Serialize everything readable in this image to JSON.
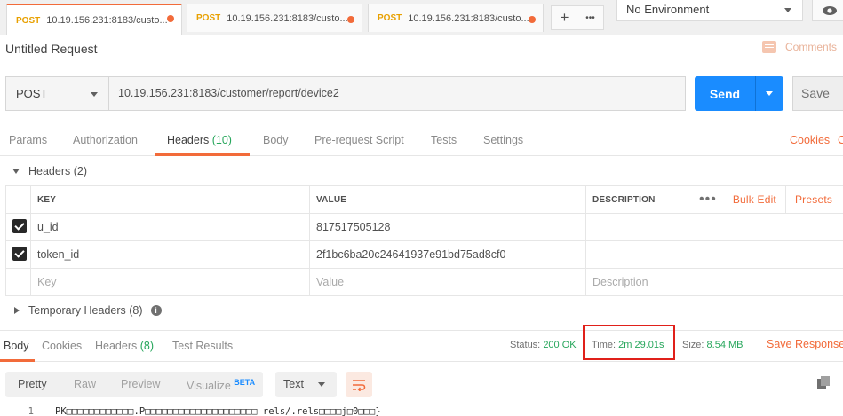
{
  "tabs": [
    {
      "method": "POST",
      "label": "10.19.156.231:8183/custo..."
    },
    {
      "method": "POST",
      "label": "10.19.156.231:8183/custo..."
    },
    {
      "method": "POST",
      "label": "10.19.156.231:8183/custo..."
    }
  ],
  "tab_controls": {
    "add": "+",
    "more": "•••"
  },
  "environment": {
    "selected": "No Environment"
  },
  "request": {
    "title": "Untitled Request",
    "comments_label": "Comments",
    "method": "POST",
    "url": "10.19.156.231:8183/customer/report/device2",
    "send_label": "Send",
    "save_label": "Save"
  },
  "request_tabs": {
    "params": "Params",
    "authorization": "Authorization",
    "headers": "Headers",
    "headers_count": "(10)",
    "body": "Body",
    "pre_request": "Pre-request Script",
    "tests": "Tests",
    "settings": "Settings",
    "cookies": "Cookies",
    "code": "C"
  },
  "headers_section": {
    "title": "Headers",
    "count": "(2)",
    "columns": {
      "key": "KEY",
      "value": "VALUE",
      "description": "DESCRIPTION"
    },
    "more": "•••",
    "bulk_edit": "Bulk Edit",
    "presets": "Presets",
    "rows": [
      {
        "key": "u_id",
        "value": "817517505128",
        "description": ""
      },
      {
        "key": "token_id",
        "value": "2f1bc6ba20c24641937e91bd75ad8cf0",
        "description": ""
      }
    ],
    "placeholder": {
      "key": "Key",
      "value": "Value",
      "description": "Description"
    },
    "temporary": {
      "title": "Temporary Headers",
      "count": "(8)"
    }
  },
  "response": {
    "tabs": {
      "body": "Body",
      "cookies": "Cookies",
      "headers": "Headers",
      "headers_count": "(8)",
      "test_results": "Test Results"
    },
    "status_label": "Status:",
    "status_value": "200 OK",
    "time_label": "Time:",
    "time_value": "2m 29.01s",
    "size_label": "Size:",
    "size_value": "8.54 MB",
    "save_label": "Save Response",
    "views": {
      "pretty": "Pretty",
      "raw": "Raw",
      "preview": "Preview",
      "visualize": "Visualize",
      "beta": "BETA"
    },
    "format": "Text",
    "line_number": "1",
    "line_text": "PK□□□□□□□□□□□□.P□□□□□□□□□□□□□□□□□□□□_rels/.rels□□□□j□0□□□}"
  },
  "colors": {
    "accent": "#f26b3a",
    "send": "#1a8cff",
    "ok": "#26a65b",
    "highlight": "#e0201a",
    "method": "#e8a000"
  }
}
